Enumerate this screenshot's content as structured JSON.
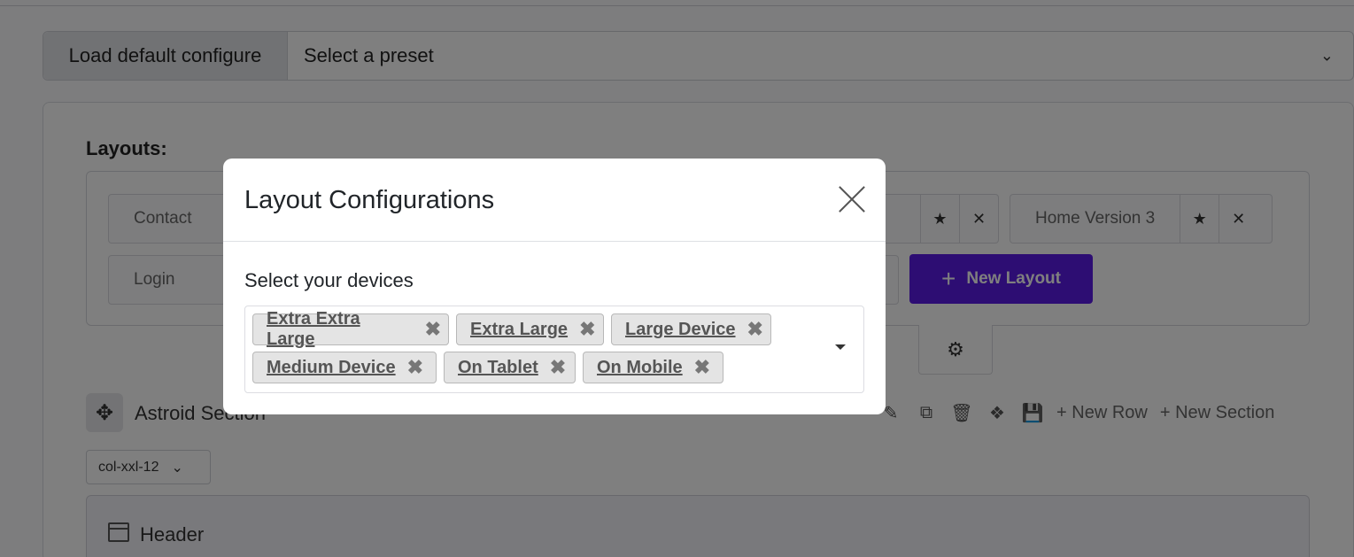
{
  "preset_bar": {
    "load_default_label": "Load default configure",
    "preset_placeholder": "Select a preset"
  },
  "layouts": {
    "title": "Layouts:",
    "pills": [
      {
        "label": "Contact"
      },
      {
        "label": "Home Version 3"
      },
      {
        "label": "Login"
      }
    ],
    "new_layout_label": "New Layout"
  },
  "section": {
    "name": "Astroid Section",
    "new_row_label": "New Row",
    "new_section_label": "New Section",
    "column_select": "col-xxl-12",
    "header_label": "Header"
  },
  "modal": {
    "title": "Layout Configurations",
    "devices_label": "Select your devices",
    "devices": [
      {
        "label": "Extra Extra Large"
      },
      {
        "label": "Extra Large"
      },
      {
        "label": "Large Device"
      },
      {
        "label": "Medium Device"
      },
      {
        "label": "On Tablet"
      },
      {
        "label": "On Mobile"
      }
    ]
  },
  "icons": {
    "remove_glyph": "✖",
    "star_glyph": "★",
    "close_glyph": "✕",
    "gear_glyph": "⚙",
    "move_glyph": "✥"
  },
  "colors": {
    "accent": "#5b1ae6",
    "backdrop": "rgba(0,0,0,0.5)"
  }
}
